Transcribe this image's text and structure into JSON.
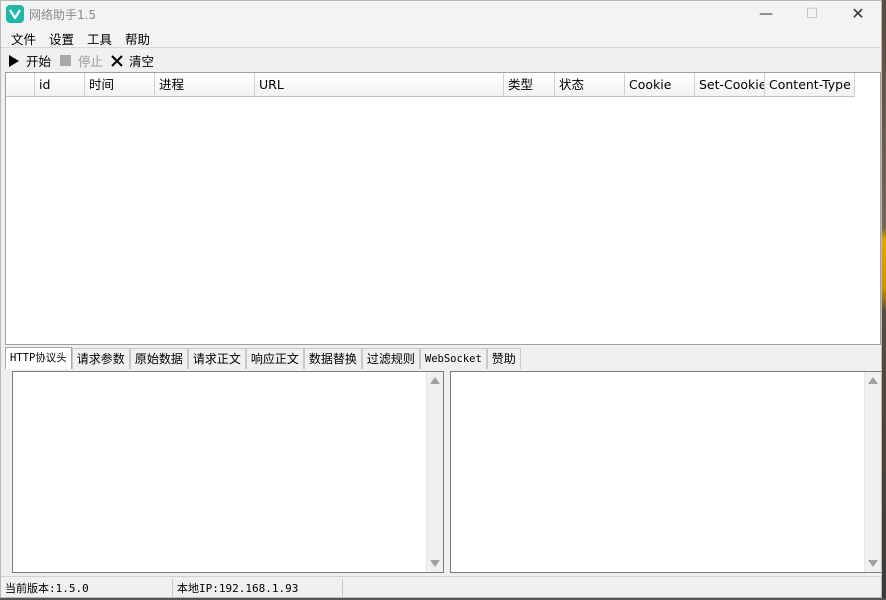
{
  "window": {
    "title": "网络助手1.5",
    "controls": {
      "minimize": "—",
      "maximize": "☐",
      "close": "✕"
    }
  },
  "colors": {
    "app_icon": "#1fb8a8",
    "disabled_text": "#999999"
  },
  "menu": {
    "items": [
      "文件",
      "设置",
      "工具",
      "帮助"
    ]
  },
  "toolbar": {
    "start_label": "开始",
    "start_icon": "play-icon",
    "stop_label": "停止",
    "stop_icon": "stop-icon",
    "clear_label": "清空",
    "clear_icon": "close-icon"
  },
  "table": {
    "columns": [
      "",
      "id",
      "时间",
      "进程",
      "URL",
      "类型",
      "状态",
      "Cookie",
      "Set-Cookie",
      "Content-Type"
    ],
    "rows": []
  },
  "tabs": [
    "HTTP协议头",
    "请求参数",
    "原始数据",
    "请求正文",
    "响应正文",
    "数据替换",
    "过滤规则",
    "WebSocket",
    "赞助"
  ],
  "active_tab": "HTTP协议头",
  "status": {
    "version": "当前版本:1.5.0",
    "ip": "本地IP:192.168.1.93"
  }
}
